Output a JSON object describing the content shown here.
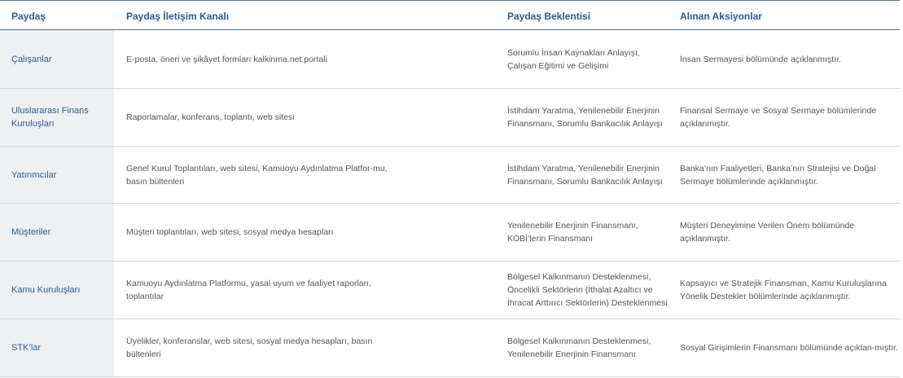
{
  "headers": [
    "Paydaş",
    "Paydaş İletişim Kanalı",
    "Paydaş Beklentisi",
    "Alınan Aksiyonlar"
  ],
  "rows": [
    {
      "name": "Çalışanlar",
      "channel": "E-posta, öneri ve şikâyet formları kalkinma.net portali",
      "expectation": "Sorumlu İnsan Kaynakları Anlayışı, Çalışan Eğitimi ve Gelişimi",
      "action": "İnsan Sermayesi bölümünde açıklanmıştır."
    },
    {
      "name": "Uluslararası Finans Kuruluşları",
      "channel": "Raporlamalar, konferans, toplantı, web sitesi",
      "expectation": "İstihdam Yaratma, Yenilenebilir Enerjinin Finansmanı, Sorumlu Bankacılık Anlayışı",
      "action": "Finansal Sermaye ve Sosyal Sermaye bölümlerinde açıklanmıştır."
    },
    {
      "name": "Yatırımcılar",
      "channel": "Genel Kurul Toplantıları, web sitesi, Kamuoyu Aydınlatma Platfor-mu, basın bültenleri",
      "expectation": "İstihdam Yaratma, Yenilenebilir Enerjinin Finansmanı, Sorumlu Bankacılık Anlayışı",
      "action": "Banka’nın Faaliyetleri, Banka’nın Stratejisi ve Doğal Sermaye bölümlerinde açıklanmıştır."
    },
    {
      "name": "Müşteriler",
      "channel": "Müşteri toplantıları, web sitesi, sosyal medya hesapları",
      "expectation": "Yenilenebilir Enerjinin Finansmanı, KOBİ’lerin Finansmanı",
      "action": "Müşteri Deneyimine Verilen Önem bölümünde açıklanmıştır."
    },
    {
      "name": "Kamu Kuruluşları",
      "channel": "Kamuoyu Aydınlatma Platformu, yasal uyum ve faaliyet raporları, toplantılar",
      "expectation": "Bölgesel Kalkınmanın Desteklenmesi, Öncelikli Sektörlerin (İthalat Azaltıcı ve İhracat Arttırıcı Sektörlerin) Desteklenmesi",
      "action": "Kapsayıcı ve Stratejik Finansman, Kamu Kuruluşlarına Yönelik Destekler bölümlerinde açıklanmıştır."
    },
    {
      "name": "STK’lar",
      "channel": "Üyelikler, konferanslar, web sitesi, sosyal medya hesapları, basın bültenleri",
      "expectation": "Bölgesel Kalkınmanın Desteklenmesi, Yenilenebilir Enerjinin Finansmanı",
      "action": "Sosyal Girişimlerin Finansmanı bölümünde açıklan-mıştır."
    }
  ]
}
